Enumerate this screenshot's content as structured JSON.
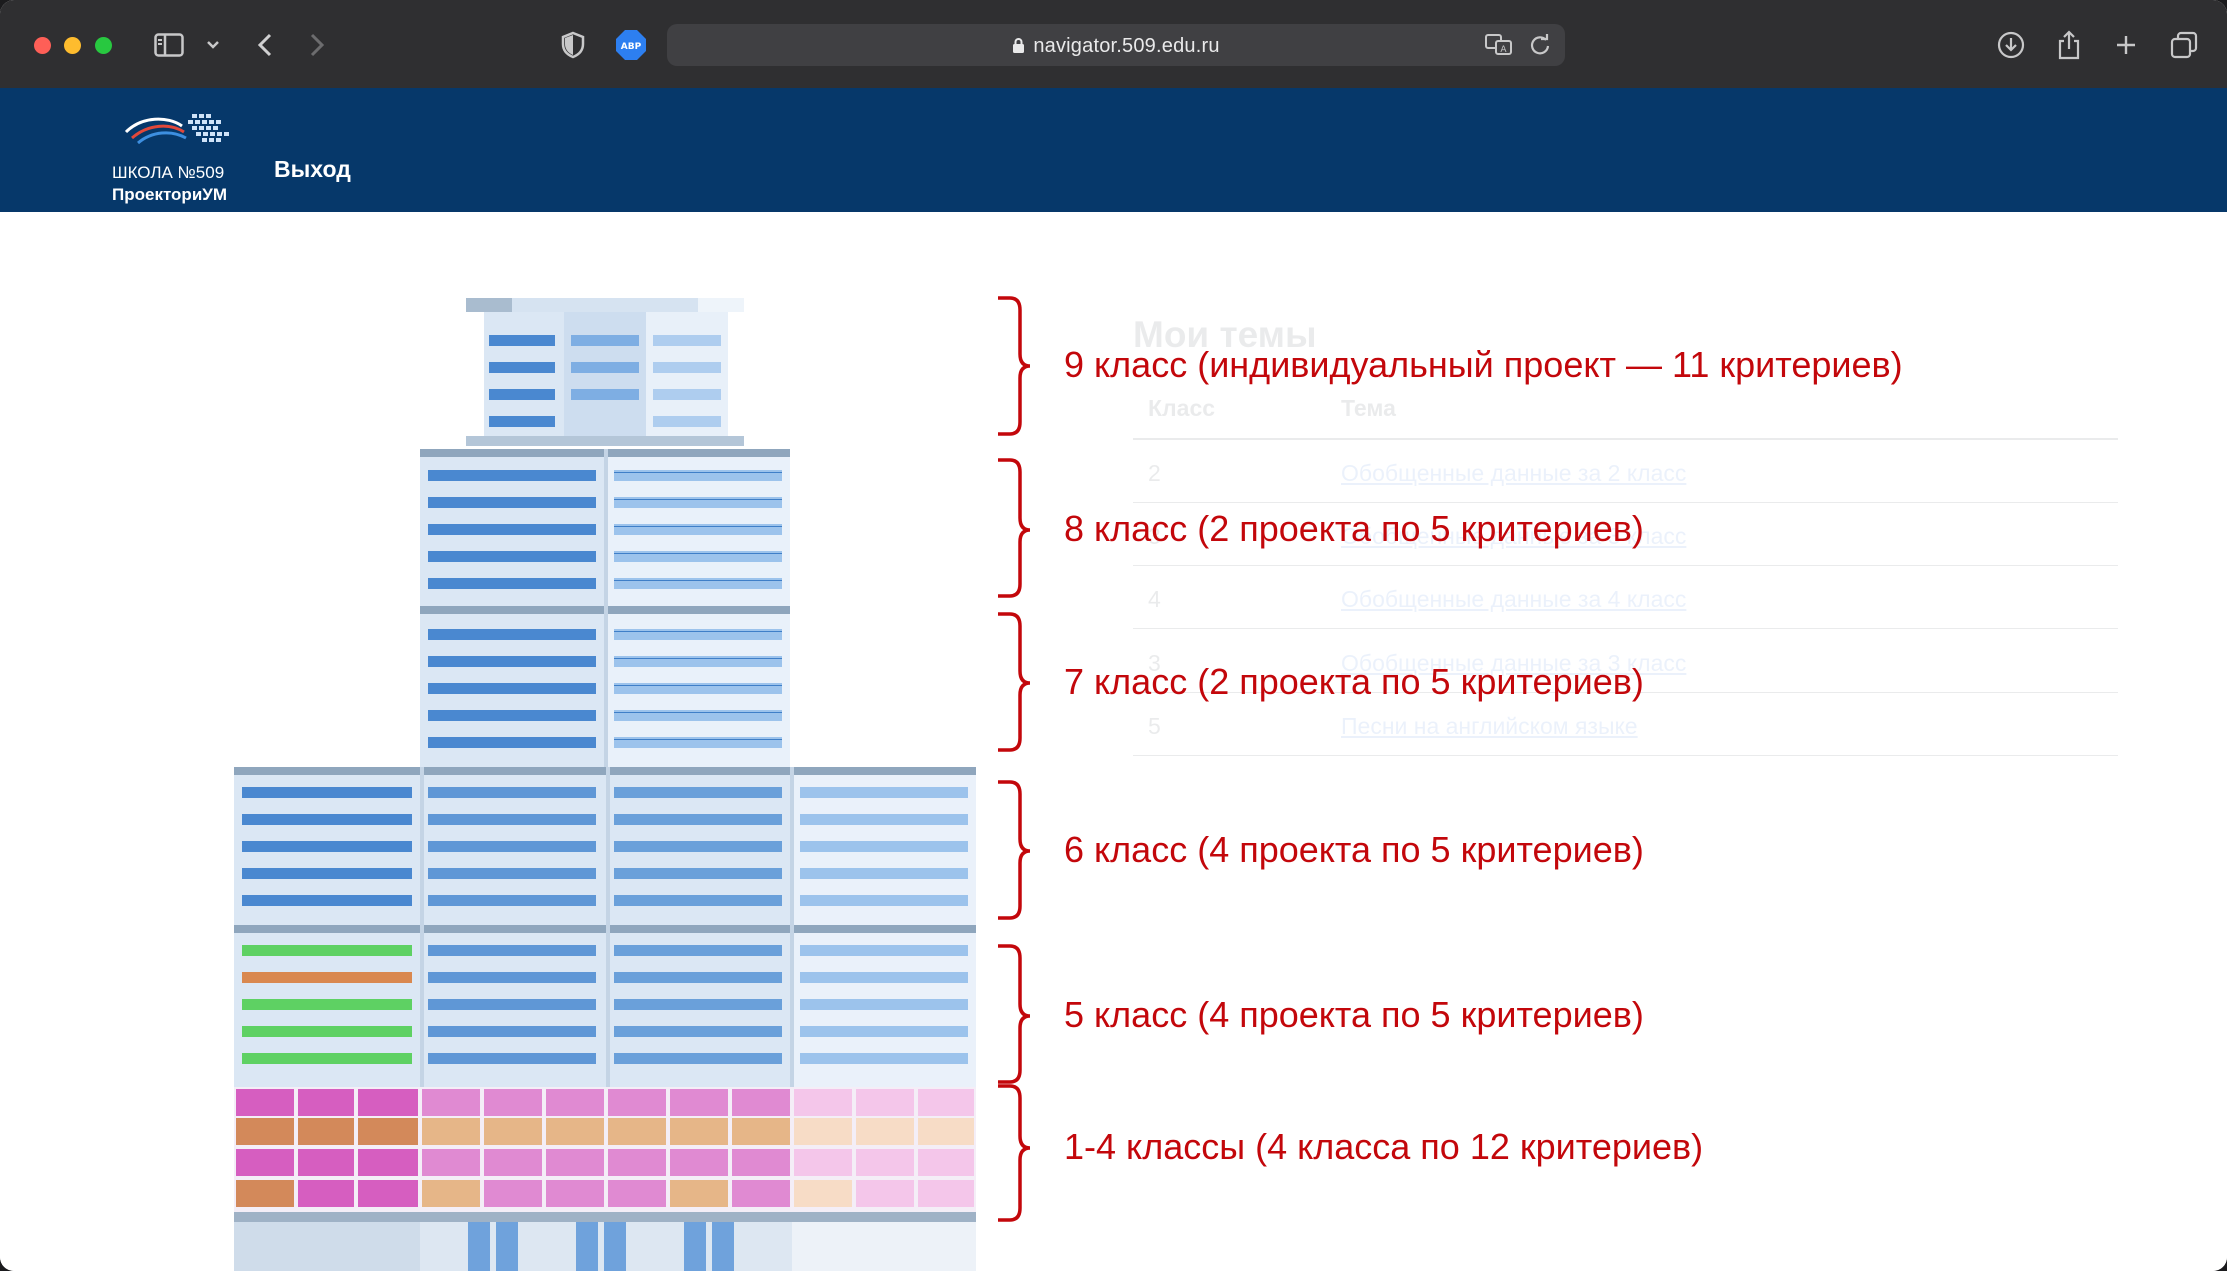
{
  "browser": {
    "url": "navigator.509.edu.ru",
    "adblock_badge": "ABP"
  },
  "site": {
    "logo_line1": "ШКОЛА №509",
    "logo_line2": "ПроекториУМ",
    "exit_label": "Выход"
  },
  "background_table": {
    "title": "Мои темы",
    "col_class": "Класс",
    "col_topic": "Тема",
    "rows": [
      {
        "class": "2",
        "topic": "Обобщенные данные за 2 класс"
      },
      {
        "class": "3",
        "topic": "Обобщенные данные за 3 класс"
      },
      {
        "class": "4",
        "topic": "Обобщенные данные за 4 класс"
      },
      {
        "class": "3",
        "topic": "Обобщенные данные за 3 класс"
      },
      {
        "class": "5",
        "topic": "Песни на английском языке"
      }
    ]
  },
  "annotations": [
    "9 класс (индивидуальный проект — 11 критериев)",
    "8 класс (2 проекта по 5 критериев)",
    "7 класс (2 проекта по 5 критериев)",
    "6 класс (4 проекта по 5 критериев)",
    "5 класс (4 проекта по 5 критериев)",
    "1-4 классы (4 класса по 12 критериев)"
  ],
  "colors": {
    "header_bg": "#06386a",
    "annotation": "#c3070b",
    "window_blue": "#4a88d0",
    "window_light": "#9cc3ec",
    "window_green": "#5ed163",
    "window_orange": "#d9884f",
    "window_magenta": "#d660c0"
  }
}
